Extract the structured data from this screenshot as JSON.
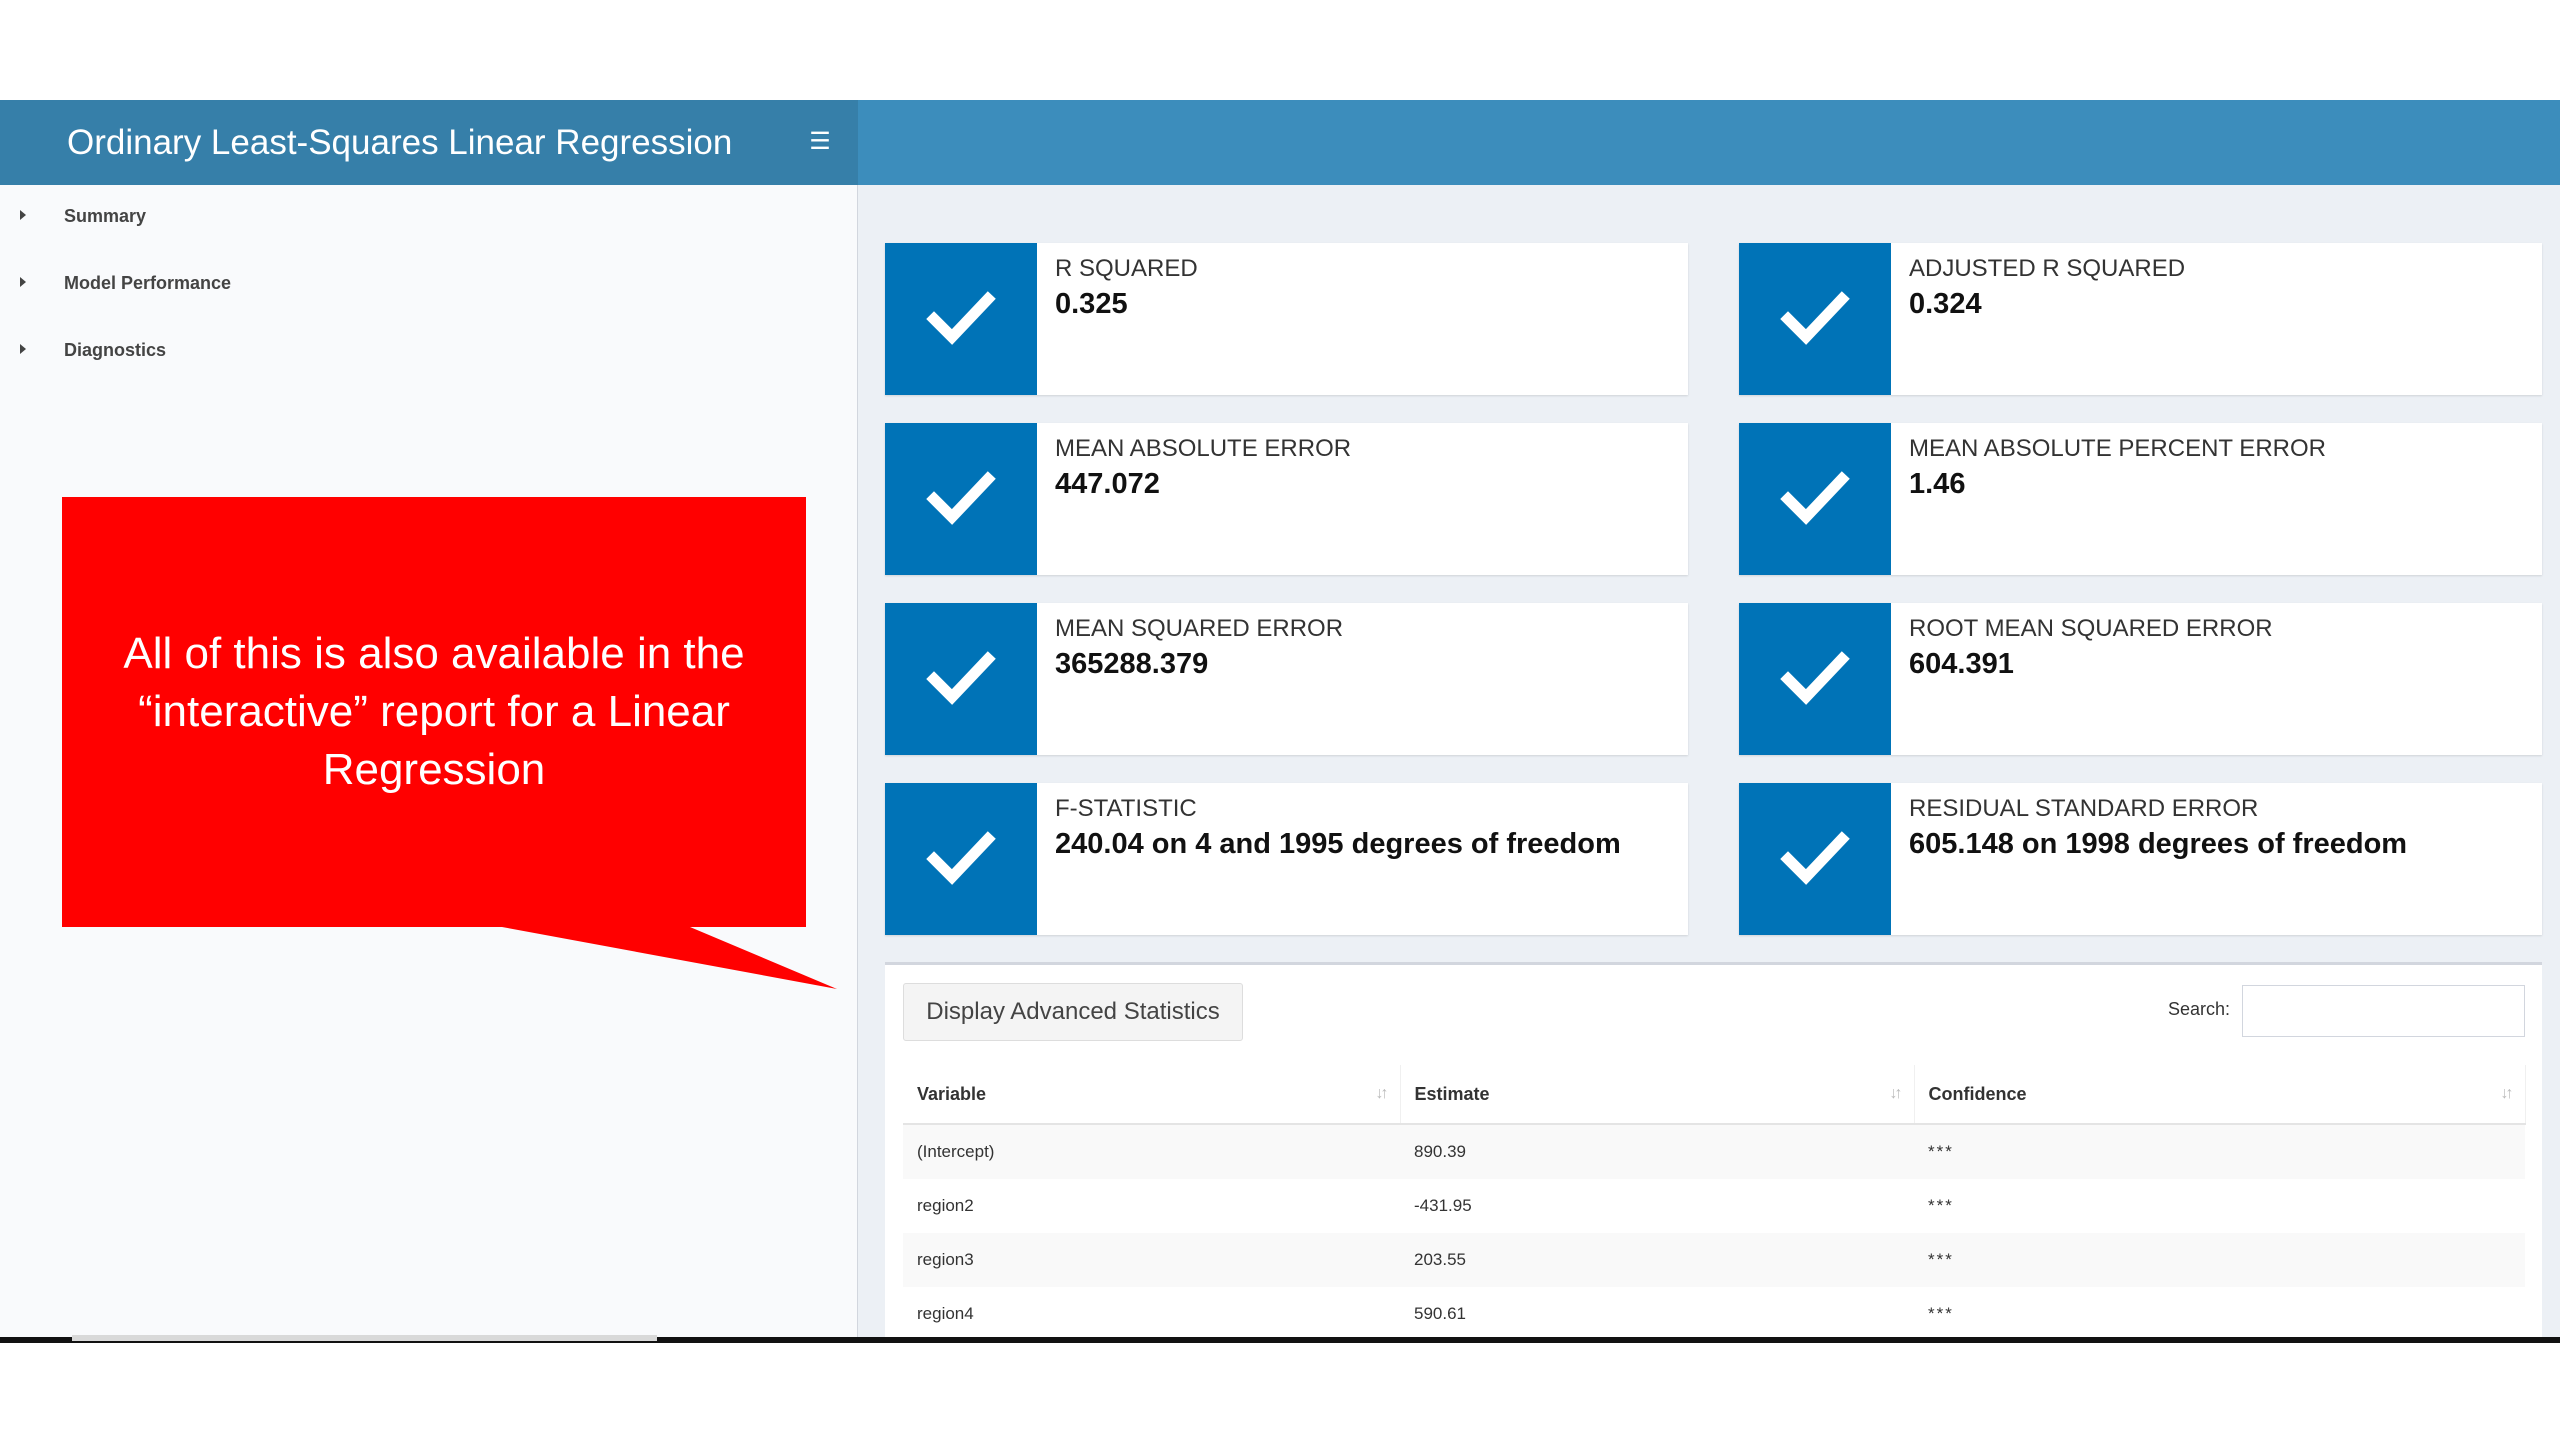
{
  "header": {
    "title": "Ordinary Least-Squares Linear Regression",
    "menu_icon": "hamburger-icon"
  },
  "sidebar": {
    "items": [
      {
        "label": "Summary"
      },
      {
        "label": "Model Performance"
      },
      {
        "label": "Diagnostics"
      }
    ]
  },
  "callout": {
    "text": "All of this is also available in the “interactive” report for a Linear Regression",
    "color": "#ff0000"
  },
  "metrics": [
    {
      "label": "R SQUARED",
      "value": "0.325",
      "icon": "check-icon"
    },
    {
      "label": "ADJUSTED R SQUARED",
      "value": "0.324",
      "icon": "check-icon"
    },
    {
      "label": "MEAN ABSOLUTE ERROR",
      "value": "447.072",
      "icon": "check-icon"
    },
    {
      "label": "MEAN ABSOLUTE PERCENT ERROR",
      "value": "1.46",
      "icon": "check-icon"
    },
    {
      "label": "MEAN SQUARED ERROR",
      "value": "365288.379",
      "icon": "check-icon"
    },
    {
      "label": "ROOT MEAN SQUARED ERROR",
      "value": "604.391",
      "icon": "check-icon"
    },
    {
      "label": "F-STATISTIC",
      "value": "240.04 on 4 and 1995 degrees of freedom",
      "icon": "check-icon"
    },
    {
      "label": "RESIDUAL STANDARD ERROR",
      "value": "605.148 on 1998 degrees of freedom",
      "icon": "check-icon"
    }
  ],
  "table_panel": {
    "advanced_button": "Display Advanced Statistics",
    "search_label": "Search:",
    "search_value": "",
    "columns": [
      "Variable",
      "Estimate",
      "Confidence"
    ],
    "rows": [
      {
        "variable": "(Intercept)",
        "estimate": "890.39",
        "confidence": "***"
      },
      {
        "variable": "region2",
        "estimate": "-431.95",
        "confidence": "***"
      },
      {
        "variable": "region3",
        "estimate": "203.55",
        "confidence": "***"
      },
      {
        "variable": "region4",
        "estimate": "590.61",
        "confidence": "***"
      }
    ]
  },
  "colors": {
    "header": "#3c8dbc",
    "brand": "#367fa9",
    "icon_bg": "#0073b7",
    "content_bg": "#ecf0f5"
  }
}
